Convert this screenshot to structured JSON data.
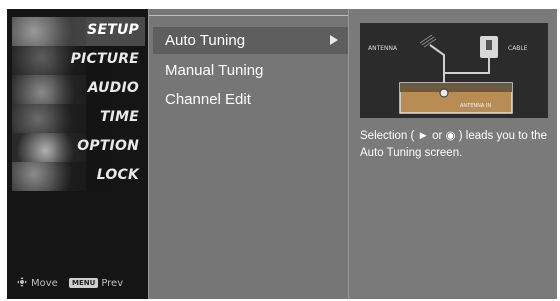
{
  "left_menu": {
    "items": [
      {
        "label": "SETUP"
      },
      {
        "label": "PICTURE"
      },
      {
        "label": "AUDIO"
      },
      {
        "label": "TIME"
      },
      {
        "label": "OPTION"
      },
      {
        "label": "LOCK"
      }
    ],
    "active_item": "SETUP"
  },
  "footer": {
    "move_label": "Move",
    "menu_key_label": "MENU",
    "prev_label": "Prev",
    "move_icon": "move-arrows-icon"
  },
  "sub_menu": {
    "items": [
      {
        "label": "Auto Tuning",
        "selected": true,
        "icon": "right-arrow-icon"
      },
      {
        "label": "Manual Tuning",
        "selected": false
      },
      {
        "label": "Channel Edit",
        "selected": false
      }
    ]
  },
  "info_panel": {
    "diagram": {
      "antenna_label": "ANTENNA",
      "cable_label": "CABLE",
      "tv_label": "ANTENNA IN"
    },
    "text": "Selection ( ► or ◉ ) leads you to the Auto Tuning screen."
  },
  "colors": {
    "background": "#6f6f6f",
    "left_panel": "#151515",
    "text": "#ffffff"
  }
}
